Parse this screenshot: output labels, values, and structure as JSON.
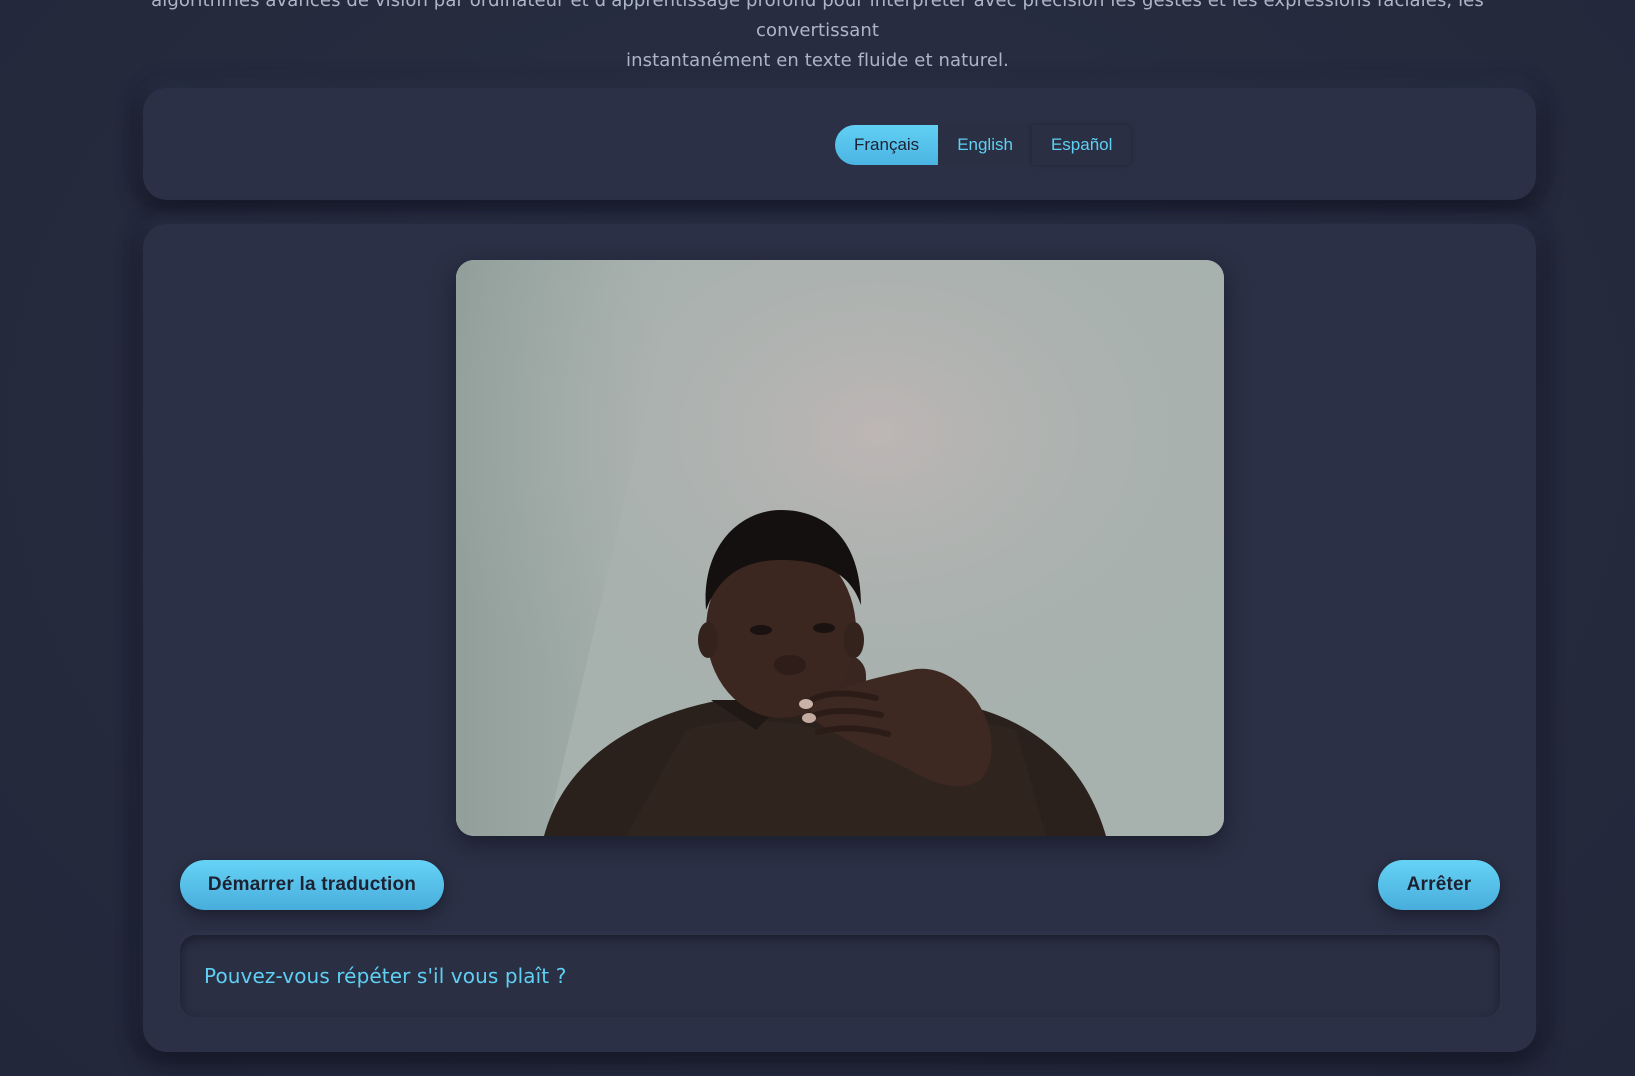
{
  "intro": {
    "line1": "algorithmes avancés de vision par ordinateur et d'apprentissage profond pour interpréter avec précision les gestes et les expressions faciales, les convertissant",
    "line2": "instantanément en texte fluide et naturel."
  },
  "languages": {
    "selected": "Français",
    "options": [
      "Français",
      "English",
      "Español"
    ]
  },
  "video": {
    "label": "camera-feed"
  },
  "controls": {
    "start_label": "Démarrer la traduction",
    "stop_label": "Arrêter"
  },
  "translation": {
    "text": "Pouvez-vous répéter s'il vous plaît ?"
  },
  "colors": {
    "accent": "#5fd0f3",
    "button_gradient_top": "#66d3f5",
    "button_gradient_bottom": "#48addc",
    "panel_bg": "#2b3046",
    "page_bg": "#262b3e",
    "button_text": "#1d2233"
  }
}
